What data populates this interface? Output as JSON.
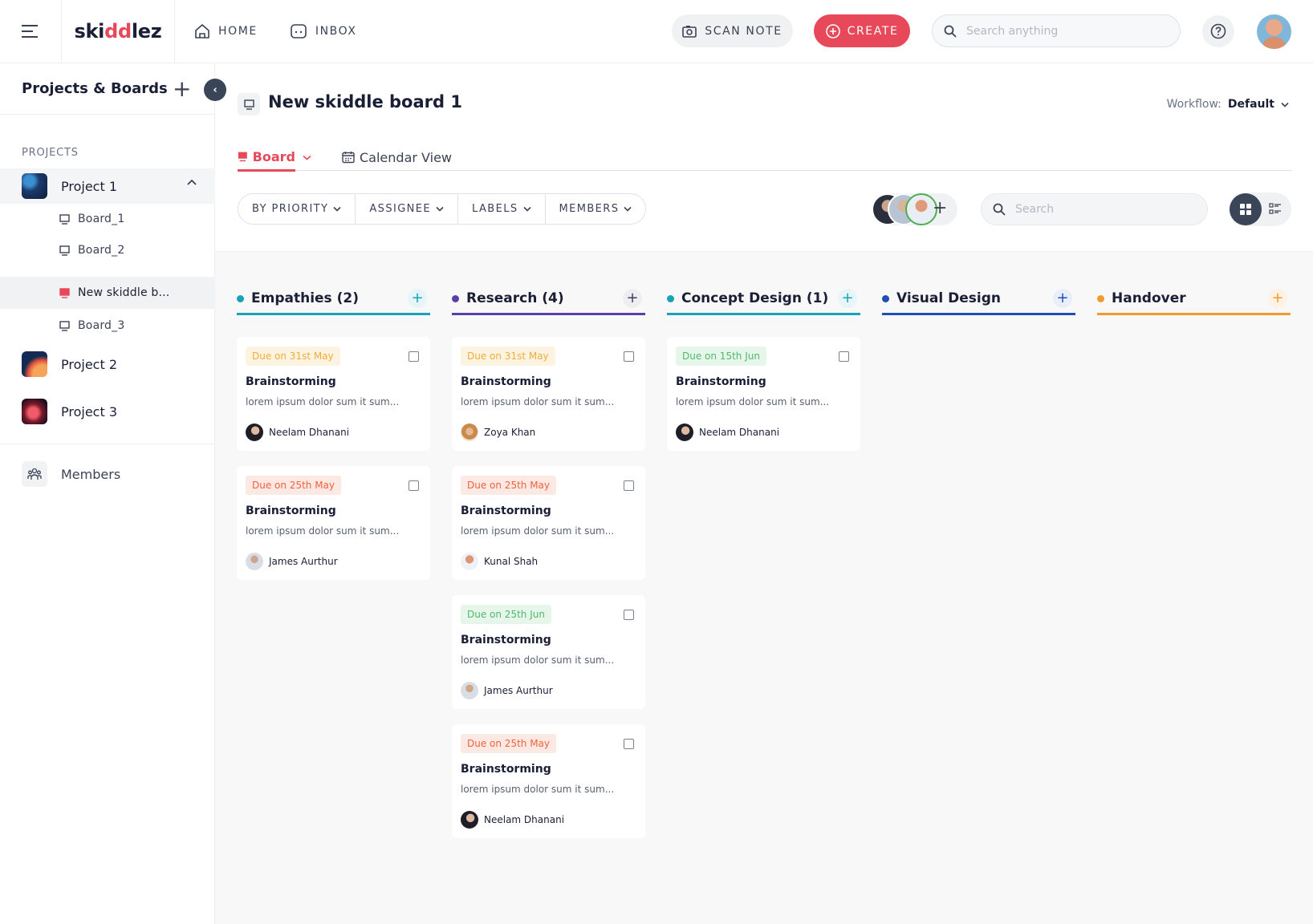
{
  "app": {
    "logo_prefix": "ski",
    "logo_highlight": "dd",
    "logo_suffix": "lez"
  },
  "topnav": {
    "home_label": "HOME",
    "inbox_label": "INBOX",
    "scan_label": "SCAN NOTE",
    "create_label": "CREATE",
    "search_placeholder": "Search anything"
  },
  "sidebar": {
    "title": "Projects & Boards",
    "section_label": "PROJECTS",
    "projects": [
      {
        "name": "Project 1",
        "expanded": true
      },
      {
        "name": "Project 2"
      },
      {
        "name": "Project 3"
      }
    ],
    "boards": [
      {
        "label": "Board_1"
      },
      {
        "label": "Board_2"
      },
      {
        "label": "New skiddle b...",
        "active": true
      },
      {
        "label": "Board_3"
      }
    ],
    "members_label": "Members"
  },
  "board": {
    "title": "New skiddle board 1",
    "workflow_label": "Workflow:",
    "workflow_value": "Default",
    "tab_board": "Board",
    "tab_calendar": "Calendar View",
    "filters": [
      "BY PRIORITY",
      "ASSIGNEE",
      "LABELS",
      "MEMBERS"
    ],
    "search_placeholder": "Search"
  },
  "columns": [
    {
      "title": "Empathies (2)",
      "color": "#17a2b8"
    },
    {
      "title": "Research (4)",
      "color": "#5b3fa8"
    },
    {
      "title": "Concept Design (1)",
      "color": "#17a2b8"
    },
    {
      "title": "Visual Design",
      "color": "#1f4fb5"
    },
    {
      "title": "Handover",
      "color": "#f39a2c"
    }
  ],
  "cards": {
    "c0_0": {
      "due": "Due on 31st May",
      "title": "Brainstorming",
      "desc": "lorem ipsum dolor sum it sum...",
      "user": "Neelam Dhanani"
    },
    "c0_1": {
      "due": "Due on 25th May",
      "title": "Brainstorming",
      "desc": "lorem ipsum dolor sum it sum...",
      "user": "James Aurthur"
    },
    "c1_0": {
      "due": "Due on 31st May",
      "title": "Brainstorming",
      "desc": "lorem ipsum dolor sum it sum...",
      "user": "Zoya Khan"
    },
    "c1_1": {
      "due": "Due on 25th May",
      "title": "Brainstorming",
      "desc": "lorem ipsum dolor sum it sum...",
      "user": "Kunal Shah"
    },
    "c1_2": {
      "due": "Due on 25th Jun",
      "title": "Brainstorming",
      "desc": "lorem ipsum dolor sum it sum...",
      "user": "James Aurthur"
    },
    "c1_3": {
      "due": "Due on 25th May",
      "title": "Brainstorming",
      "desc": "lorem ipsum dolor sum it sum...",
      "user": "Neelam Dhanani"
    },
    "c2_0": {
      "due": "Due on 15th Jun",
      "title": "Brainstorming",
      "desc": "lorem ipsum dolor sum it sum...",
      "user": "Neelam Dhanani"
    }
  },
  "colors": {
    "brand": "#e8495a",
    "dark": "#1a1f36",
    "due_amber": "#f0ad3b",
    "due_red": "#f0613a",
    "due_green": "#52b86a"
  }
}
